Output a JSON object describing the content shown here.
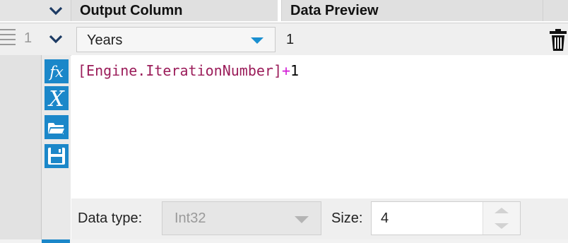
{
  "header": {
    "output_column_label": "Output Column",
    "data_preview_label": "Data Preview",
    "collapse_icon": "chevron-down-icon"
  },
  "expression_row": {
    "row_number": "1",
    "field_value": "Years",
    "preview_value": "1",
    "drag_icon": "drag-handle-icon",
    "delete_icon": "trash-icon"
  },
  "toolbar": {
    "icons": [
      "function-icon",
      "variable-icon",
      "open-folder-icon",
      "save-icon"
    ],
    "function_glyph": "fx",
    "variable_glyph": "X"
  },
  "editor": {
    "expression_field": "[Engine.IterationNumber]",
    "expression_operator": "+",
    "expression_number": "1"
  },
  "config": {
    "data_type_label": "Data type:",
    "data_type_value": "Int32",
    "size_label": "Size:",
    "size_value": "4"
  },
  "colors": {
    "accent": "#1b87c9",
    "field_token": "#9b1d5a",
    "operator_token": "#d21bd6"
  }
}
